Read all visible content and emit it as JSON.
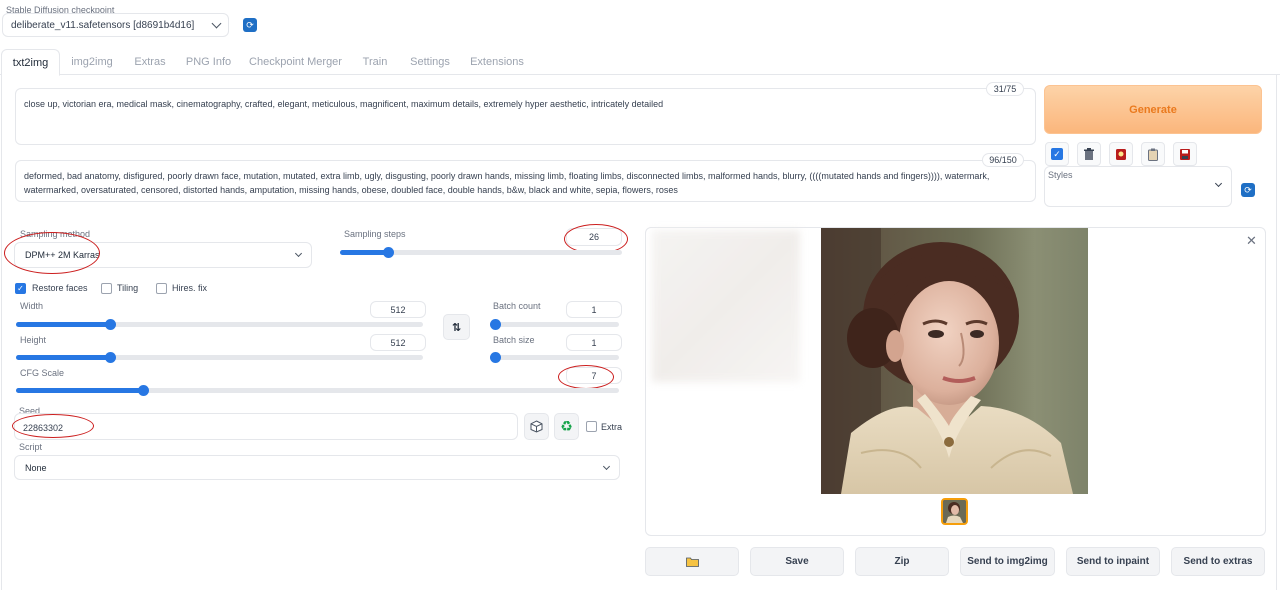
{
  "checkpoint": {
    "label": "Stable Diffusion checkpoint",
    "value": "deliberate_v11.safetensors [d8691b4d16]"
  },
  "tabs": [
    "txt2img",
    "img2img",
    "Extras",
    "PNG Info",
    "Checkpoint Merger",
    "Train",
    "Settings",
    "Extensions"
  ],
  "active_tab": "txt2img",
  "prompt": {
    "text": "close up, victorian era, medical mask, cinematography, crafted, elegant, meticulous, magnificent, maximum details, extremely hyper aesthetic, intricately detailed",
    "counter": "31/75"
  },
  "negative_prompt": {
    "text": "deformed, bad anatomy, disfigured, poorly drawn face, mutation, mutated, extra limb, ugly, disgusting, poorly drawn hands, missing limb, floating limbs, disconnected limbs, malformed hands, blurry, ((((mutated hands and fingers)))), watermark, watermarked, oversaturated, censored, distorted hands, amputation, missing hands, obese, doubled face, double hands, b&w, black and white, sepia, flowers, roses",
    "counter": "96/150"
  },
  "generate_label": "Generate",
  "styles_label": "Styles",
  "tool_icons": [
    "checkbox-icon",
    "trash-icon",
    "red-card-icon",
    "clipboard-icon",
    "save-disk-icon"
  ],
  "sampling_method": {
    "label": "Sampling method",
    "value": "DPM++ 2M Karras"
  },
  "sampling_steps": {
    "label": "Sampling steps",
    "value": "26",
    "fraction": 0.17
  },
  "checkboxes": {
    "restore_faces": {
      "label": "Restore faces",
      "checked": true
    },
    "tiling": {
      "label": "Tiling",
      "checked": false
    },
    "hires_fix": {
      "label": "Hires. fix",
      "checked": false
    }
  },
  "width": {
    "label": "Width",
    "value": "512",
    "fraction": 0.23
  },
  "height": {
    "label": "Height",
    "value": "512",
    "fraction": 0.23
  },
  "batch_count": {
    "label": "Batch count",
    "value": "1",
    "fraction": 0.0
  },
  "batch_size": {
    "label": "Batch size",
    "value": "1",
    "fraction": 0.0
  },
  "cfg_scale": {
    "label": "CFG Scale",
    "value": "7",
    "fraction": 0.21
  },
  "seed": {
    "label": "Seed",
    "value": "22863302",
    "extra_label": "Extra"
  },
  "script": {
    "label": "Script",
    "value": "None"
  },
  "actions": [
    "Save",
    "Zip",
    "Send to img2img",
    "Send to inpaint",
    "Send to extras"
  ],
  "colors": {
    "accent": "#2777e3",
    "generate": "#fbb67c",
    "annotation": "#cc1f1f"
  }
}
